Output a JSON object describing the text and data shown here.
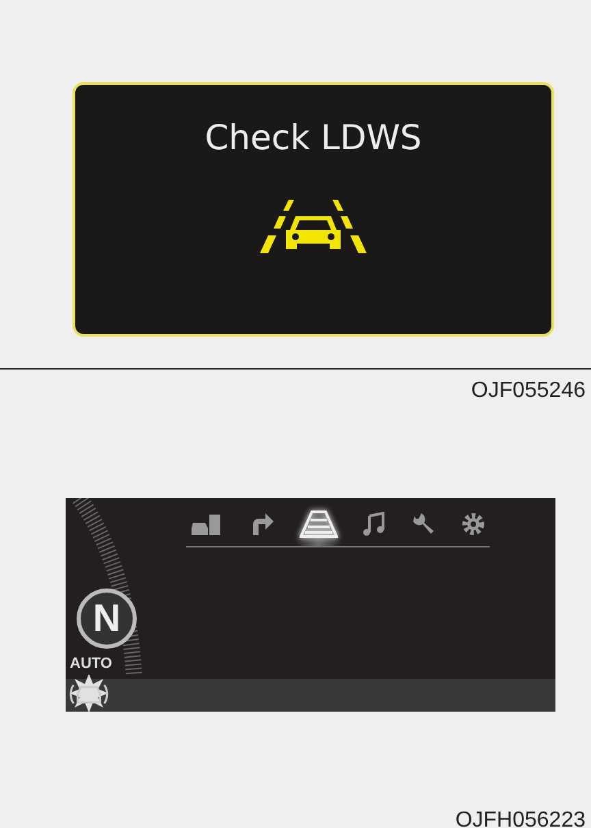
{
  "warning_figure": {
    "message": "Check LDWS",
    "caption": "OJF055246"
  },
  "cluster_figure": {
    "menu_tabs": [
      {
        "kind": "vehicle",
        "selected": false
      },
      {
        "kind": "turn",
        "selected": false
      },
      {
        "kind": "lane",
        "selected": true
      },
      {
        "kind": "music",
        "selected": false
      },
      {
        "kind": "wrench",
        "selected": false
      },
      {
        "kind": "gear",
        "selected": false
      }
    ],
    "gear": "N",
    "auto_hold_label": [
      "AUTO"
    ],
    "auto_hold_lit": true,
    "caption": "OJFH056223"
  }
}
